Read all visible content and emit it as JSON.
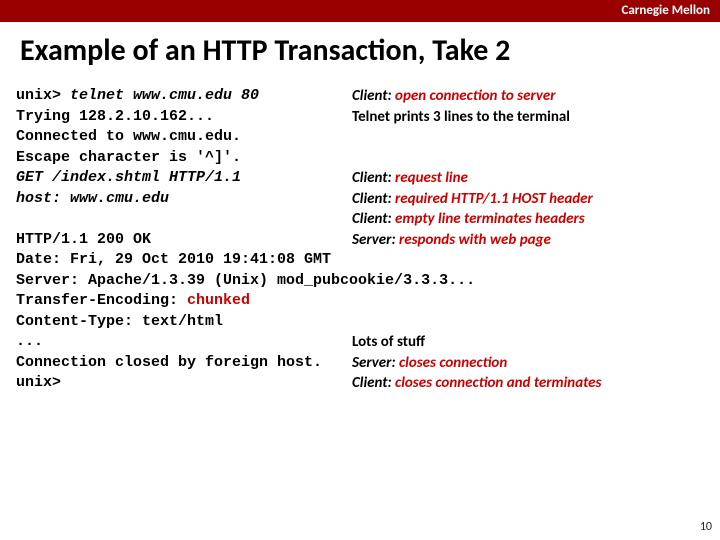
{
  "header": {
    "brand": "Carnegie Mellon"
  },
  "title": "Example of an HTTP Transaction, Take 2",
  "rows": [
    {
      "left": [
        {
          "t": "unix> "
        },
        {
          "t": "telnet www.cmu.edu 80",
          "em": true
        }
      ],
      "right": [
        {
          "t": "Client: ",
          "em": true
        },
        {
          "t": "open connection to server",
          "em": true,
          "red": true
        }
      ]
    },
    {
      "left": [
        {
          "t": "Trying 128.2.10.162..."
        }
      ],
      "right": [
        {
          "t": "Telnet prints 3 lines to the terminal"
        }
      ]
    },
    {
      "left": [
        {
          "t": "Connected to www.cmu.edu."
        }
      ]
    },
    {
      "left": [
        {
          "t": "Escape character is '^]'."
        }
      ]
    },
    {
      "left": [
        {
          "t": "GET /index.shtml HTTP/1.1",
          "em": true
        }
      ],
      "right": [
        {
          "t": "Client: ",
          "em": true
        },
        {
          "t": "request line",
          "em": true,
          "red": true
        }
      ]
    },
    {
      "left": [
        {
          "t": "host: www.cmu.edu",
          "em": true
        }
      ],
      "right": [
        {
          "t": "Client: ",
          "em": true
        },
        {
          "t": "required HTTP/1.1 HOST header",
          "em": true,
          "red": true
        }
      ]
    },
    {
      "right": [
        {
          "t": "Client: ",
          "em": true
        },
        {
          "t": "empty line terminates headers",
          "em": true,
          "red": true
        }
      ]
    },
    {
      "left": [
        {
          "t": "HTTP/1.1 200 OK"
        }
      ],
      "right": [
        {
          "t": "Server: ",
          "em": true
        },
        {
          "t": "responds with web page",
          "em": true,
          "red": true
        }
      ]
    },
    {
      "left": [
        {
          "t": "Date: Fri, 29 Oct 2010 19:41:08 GMT"
        }
      ]
    },
    {
      "left": [
        {
          "t": "Server: Apache/1.3.39 (Unix) mod_pubcookie/3.3.3..."
        }
      ]
    },
    {
      "left": [
        {
          "t": "Transfer-Encoding: "
        },
        {
          "t": "chunked",
          "red": true
        }
      ]
    },
    {
      "left": [
        {
          "t": "Content-Type: text/html"
        }
      ]
    },
    {
      "left": [
        {
          "t": "..."
        }
      ],
      "right": [
        {
          "t": "Lots of stuff"
        }
      ]
    },
    {
      "left": [
        {
          "t": "Connection closed by foreign host."
        }
      ],
      "right": [
        {
          "t": "Server: ",
          "em": true
        },
        {
          "t": "closes connection",
          "em": true,
          "red": true
        }
      ]
    },
    {
      "left": [
        {
          "t": "unix>"
        }
      ],
      "right": [
        {
          "t": "Client: ",
          "em": true
        },
        {
          "t": "closes connection and terminates",
          "em": true,
          "red": true
        }
      ]
    }
  ],
  "page_number": "10"
}
